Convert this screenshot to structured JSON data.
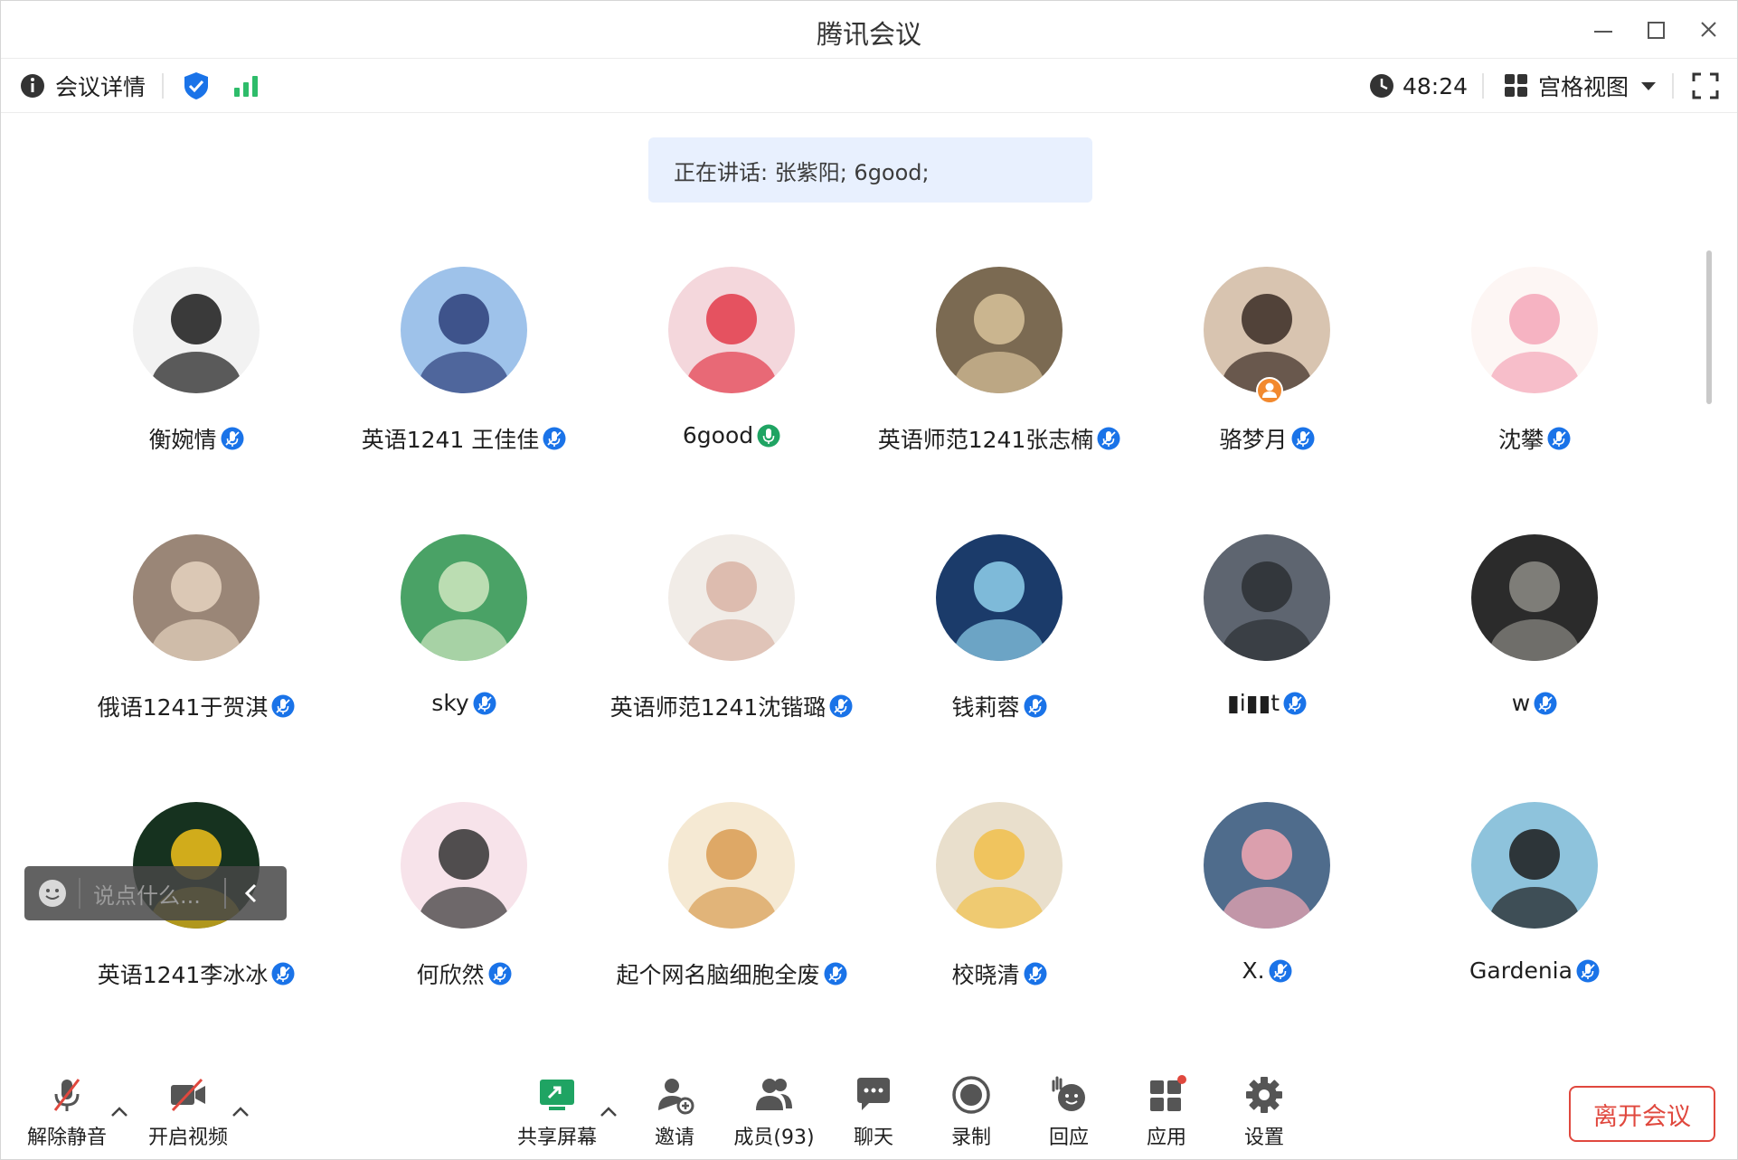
{
  "app": {
    "title": "腾讯会议"
  },
  "toolbar": {
    "details_label": "会议详情",
    "timer": "48:24",
    "view_label": "宫格视图"
  },
  "speaking": {
    "text": "正在讲话: 张紫阳; 6good;"
  },
  "participants": [
    {
      "name": "衡婉情",
      "mic": "muted"
    },
    {
      "name": "英语1241 王佳佳",
      "mic": "muted"
    },
    {
      "name": "6good",
      "mic": "active"
    },
    {
      "name": "英语师范1241张志楠",
      "mic": "muted"
    },
    {
      "name": "骆梦月",
      "mic": "muted",
      "host_badge": true
    },
    {
      "name": "沈攀",
      "mic": "muted"
    },
    {
      "name": "俄语1241于贺淇",
      "mic": "muted"
    },
    {
      "name": "sky",
      "mic": "muted"
    },
    {
      "name": "英语师范1241沈锴璐",
      "mic": "muted"
    },
    {
      "name": "钱莉蓉",
      "mic": "muted"
    },
    {
      "name": "▮i▮▮t",
      "mic": "muted"
    },
    {
      "name": "w",
      "mic": "muted"
    },
    {
      "name": "英语1241李冰冰",
      "mic": "muted"
    },
    {
      "name": "何欣然",
      "mic": "muted"
    },
    {
      "name": "起个网名脑细胞全废",
      "mic": "muted"
    },
    {
      "name": "校晓清",
      "mic": "muted"
    },
    {
      "name": "X.",
      "mic": "muted"
    },
    {
      "name": "Gardenia",
      "mic": "muted"
    }
  ],
  "chat": {
    "placeholder": "说点什么..."
  },
  "bottombar": {
    "unmute": "解除静音",
    "start_video": "开启视频",
    "share_screen": "共享屏幕",
    "invite": "邀请",
    "members": "成员(93)",
    "chat": "聊天",
    "record": "录制",
    "react": "回应",
    "apps": "应用",
    "settings": "设置",
    "leave": "离开会议"
  },
  "colors": {
    "accent": "#1a73e8",
    "leave": "#e0483e",
    "signal": "#2ebc6a",
    "mic_active": "#1fa463"
  }
}
